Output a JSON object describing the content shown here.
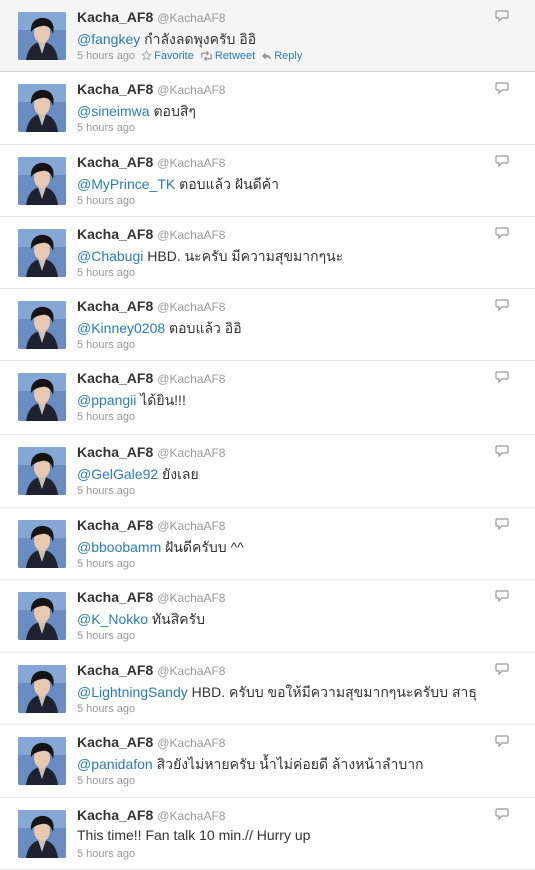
{
  "user": {
    "name": "Kacha_AF8",
    "handle": "@KachaAF8"
  },
  "actions": {
    "favorite": "Favorite",
    "retweet": "Retweet",
    "reply": "Reply"
  },
  "tweets": [
    {
      "mention": "@fangkey",
      "text": " กำลังลดพุงครับ อิอิ",
      "time": "5 hours ago",
      "hovered": true
    },
    {
      "mention": "@sineimwa",
      "text": " ตอบสิๆ",
      "time": "5 hours ago"
    },
    {
      "mention": "@MyPrince_TK",
      "text": " ตอบแล้ว ฝันดีค้า",
      "time": "5 hours ago"
    },
    {
      "mention": "@Chabugi",
      "text": " HBD. นะครับ มีความสุขมากๆนะ",
      "time": "5 hours ago"
    },
    {
      "mention": "@Kinney0208",
      "text": " ตอบแล้ว อิอิ",
      "time": "5 hours ago"
    },
    {
      "mention": "@ppangii",
      "text": " ได้ยิน!!!",
      "time": "5 hours ago"
    },
    {
      "mention": "@GelGale92",
      "text": " ยังเลย",
      "time": "5 hours ago"
    },
    {
      "mention": "@bboobamm",
      "text": " ฝันดีครับบ ^^",
      "time": "5 hours ago"
    },
    {
      "mention": "@K_Nokko",
      "text": " ทันสิครับ",
      "time": "5 hours ago"
    },
    {
      "mention": "@LightningSandy",
      "text": " HBD. ครับบ ขอให้มีความสุขมากๆนะครับบ สาธุ",
      "time": "5 hours ago"
    },
    {
      "mention": "@panidafon",
      "text": " สิวยังไม่หายครับ น้ำไม่ค่อยดี ล้างหน้าลำบาก",
      "time": "5 hours ago"
    },
    {
      "mention": "",
      "text": "This time!! Fan talk 10 min.// Hurry up",
      "time": "5 hours ago"
    }
  ]
}
